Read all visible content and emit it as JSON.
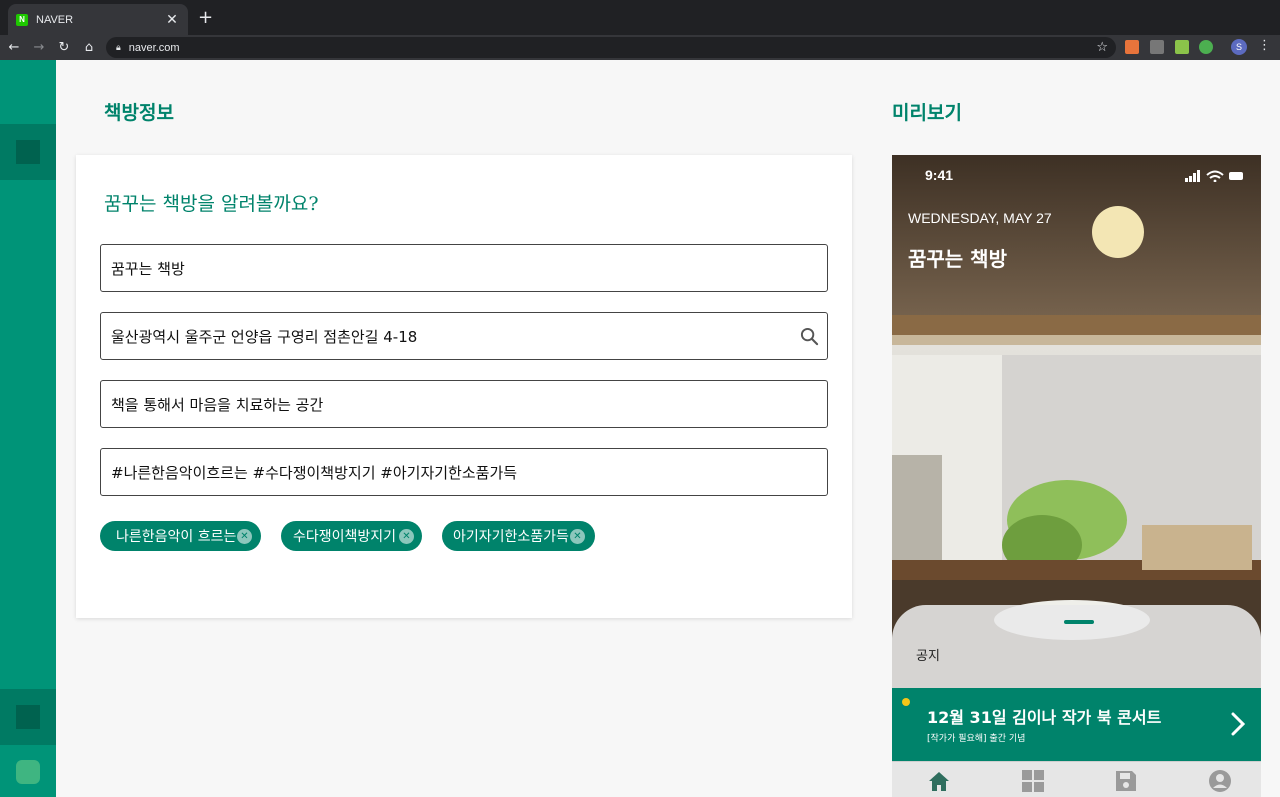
{
  "browser": {
    "tab_title": "NAVER",
    "favicon_letter": "N",
    "url": "naver.com",
    "profile_initial": "S"
  },
  "left_section": {
    "title": "책방정보",
    "heading": "꿈꾸는 책방을 알려볼까요?",
    "name_value": "꿈꾸는 책방",
    "address_value": "울산광역시 울주군 언양읍 구영리 점촌안길 4-18",
    "description_value": "책을 통해서 마음을 치료하는 공간",
    "tags_value": "#나른한음악이흐르는 #수다쟁이책방지기 #아기자기한소품가득",
    "chips": [
      "나른한음악이 흐르는",
      "수다쟁이책방지기",
      "아기자기한소품가득"
    ]
  },
  "preview": {
    "title": "미리보기",
    "status_time": "9:41",
    "date": "WEDNESDAY, MAY 27",
    "store_name": "꿈꾸는 책방",
    "notice_label": "공지",
    "banner_title": "12월 31일 김이나 작가 북 콘서트",
    "banner_subtitle": "[작가가 필요해] 출간 기념"
  },
  "colors": {
    "brand": "#00836b",
    "sidebar": "#009478",
    "banner_dot": "#f5c518"
  },
  "icons": [
    "search-icon",
    "home-icon",
    "grid-icon",
    "save-icon",
    "account-icon",
    "chevron-right-icon",
    "chip-remove-icon"
  ]
}
